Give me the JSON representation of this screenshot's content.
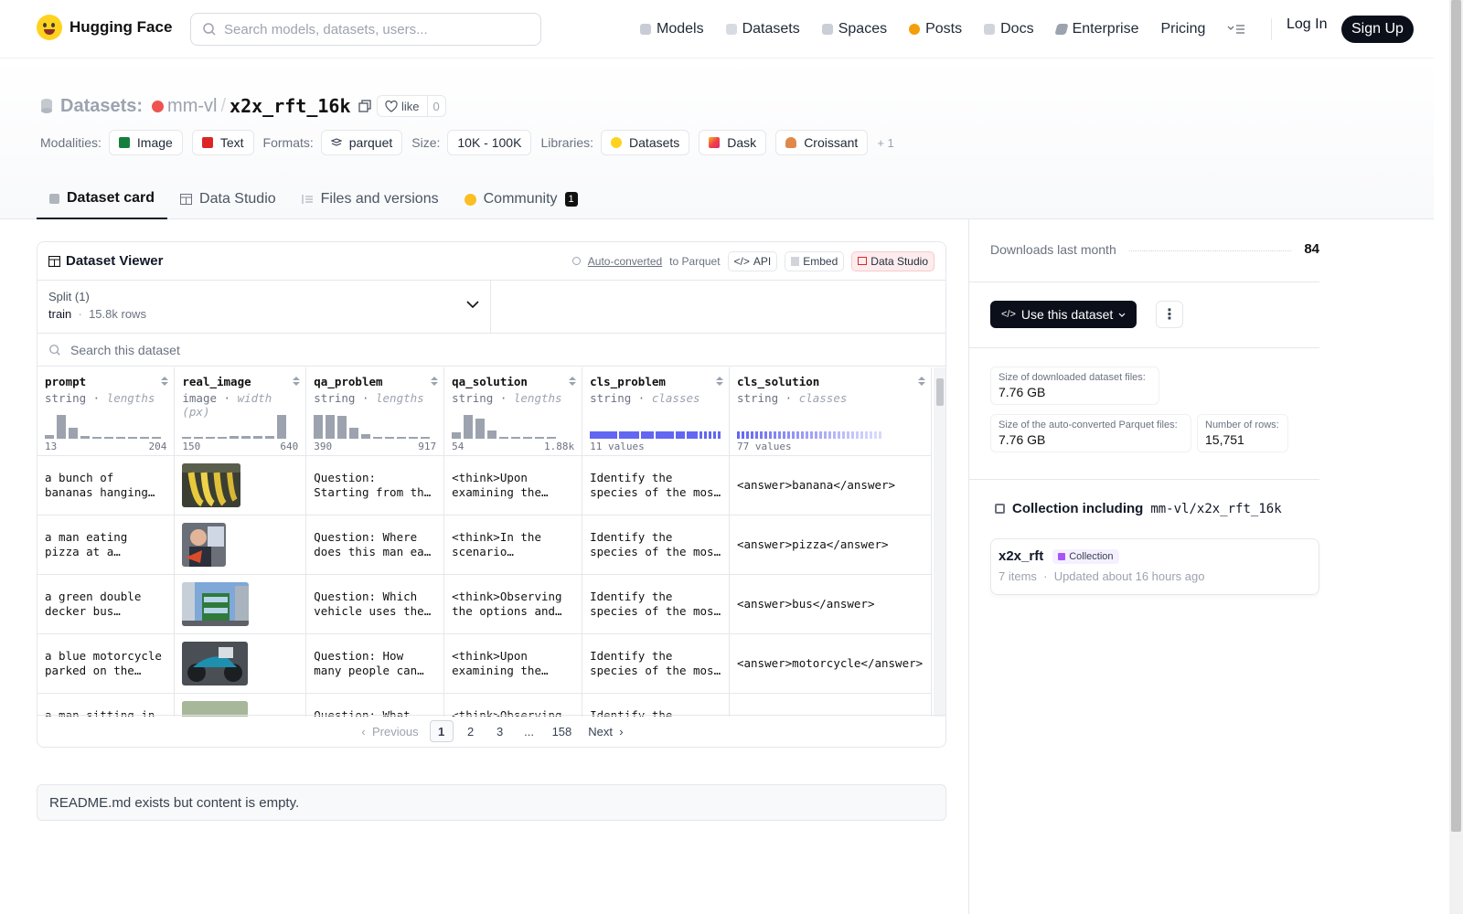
{
  "nav": {
    "brand": "Hugging Face",
    "search_placeholder": "Search models, datasets, users...",
    "links": [
      "Models",
      "Datasets",
      "Spaces",
      "Posts",
      "Docs",
      "Enterprise",
      "Pricing"
    ],
    "login": "Log In",
    "signup": "Sign Up"
  },
  "header": {
    "section": "Datasets:",
    "owner": "mm-vl",
    "name": "x2x_rft_16k",
    "like_label": "like",
    "like_count": "0",
    "modalities_label": "Modalities:",
    "modalities": [
      "Image",
      "Text"
    ],
    "formats_label": "Formats:",
    "format": "parquet",
    "size_label": "Size:",
    "size": "10K - 100K",
    "libraries_label": "Libraries:",
    "libraries": [
      "Datasets",
      "Dask",
      "Croissant"
    ],
    "more_libraries": "+ 1"
  },
  "tabs": [
    {
      "label": "Dataset card",
      "active": true
    },
    {
      "label": "Data Studio"
    },
    {
      "label": "Files and versions"
    },
    {
      "label": "Community",
      "badge": "1"
    }
  ],
  "viewer": {
    "title": "Dataset Viewer",
    "auto_converted": "Auto-converted",
    "to_parquet": "to Parquet",
    "api": "API",
    "embed": "Embed",
    "data_studio": "Data Studio",
    "split_label": "Split (1)",
    "split_name": "train",
    "split_rows": "15.8k rows",
    "search_placeholder": "Search this dataset",
    "columns": [
      {
        "name": "prompt",
        "type": "string",
        "stat": "lengths",
        "min": "13",
        "max": "204",
        "hist": [
          0.15,
          1,
          0.45,
          0.1,
          0.05,
          0.05,
          0.05,
          0.05,
          0.05,
          0.05
        ]
      },
      {
        "name": "real_image",
        "type": "image",
        "stat": "width (px)",
        "min": "150",
        "max": "640",
        "hist": [
          0.05,
          0.05,
          0.05,
          0.05,
          0.1,
          0.12,
          0.12,
          0.1,
          1
        ]
      },
      {
        "name": "qa_problem",
        "type": "string",
        "stat": "lengths",
        "min": "390",
        "max": "917",
        "hist": [
          1,
          1,
          0.95,
          0.45,
          0.2,
          0.08,
          0.05,
          0.05,
          0.05,
          0.05
        ]
      },
      {
        "name": "qa_solution",
        "type": "string",
        "stat": "lengths",
        "min": "54",
        "max": "1.88k",
        "hist": [
          0.25,
          1,
          0.85,
          0.35,
          0.08,
          0.05,
          0.05,
          0.05,
          0.05
        ]
      },
      {
        "name": "cls_problem",
        "type": "string",
        "stat": "classes",
        "values": "11 values"
      },
      {
        "name": "cls_solution",
        "type": "string",
        "stat": "classes",
        "values": "77 values"
      }
    ],
    "rows": [
      {
        "prompt": "a bunch of bananas hanging from a line",
        "qa_problem": "Question: Starting from the right, which banana...",
        "qa_solution": "<think>Upon examining the image...",
        "cls_problem": "Identify the species of the most prominent object",
        "cls_solution": "<answer>banana</answer>",
        "img": "banana"
      },
      {
        "prompt": "a man eating pizza at a computer",
        "qa_problem": "Question: Where does this man eat pizza...",
        "qa_solution": "<think>In the scenario presented...",
        "cls_problem": "Identify the species of the most prominent object",
        "cls_solution": "<answer>pizza</answer>",
        "img": "pizza"
      },
      {
        "prompt": "a green double decker bus driving down the street",
        "qa_problem": "Question: Which vehicle uses the most...",
        "qa_solution": "<think>Observing the options and the image...",
        "cls_problem": "Identify the species of the most prominent object",
        "cls_solution": "<answer>bus</answer>",
        "img": "bus"
      },
      {
        "prompt": "a blue motorcycle parked on the street",
        "qa_problem": "Question: How many people can ride...",
        "qa_solution": "<think>Upon examining the image...",
        "cls_problem": "Identify the species of the most prominent object",
        "cls_solution": "<answer>motorcycle</answer>",
        "img": "moto"
      },
      {
        "prompt": "a man sitting in a park",
        "qa_problem": "Question: What mood does...",
        "qa_solution": "<think>Observing the scene...",
        "cls_problem": "Identify the species of the most prominent object",
        "cls_solution": "",
        "img": "park"
      }
    ],
    "pager": {
      "prev": "Previous",
      "pages": [
        "1",
        "2",
        "3",
        "...",
        "158"
      ],
      "next": "Next",
      "current": "1"
    }
  },
  "readme": "README.md exists but content is empty.",
  "sidebar": {
    "downloads_label": "Downloads last month",
    "downloads": "84",
    "use_button": "Use this dataset",
    "stats": [
      {
        "k": "Size of downloaded dataset files:",
        "v": "7.76 GB"
      },
      {
        "k": "Size of the auto-converted Parquet files:",
        "v": "7.76 GB"
      },
      {
        "k": "Number of rows:",
        "v": "15,751"
      }
    ],
    "collection_heading": "Collection including",
    "collection_repo": "mm-vl/x2x_rft_16k",
    "collection": {
      "name": "x2x_rft",
      "tag": "Collection",
      "items": "7 items",
      "updated": "Updated about 16 hours ago"
    }
  },
  "colors": {
    "accent": "#6366f1",
    "brand_yellow": "#ffd21e",
    "dark": "#0b0f19"
  }
}
